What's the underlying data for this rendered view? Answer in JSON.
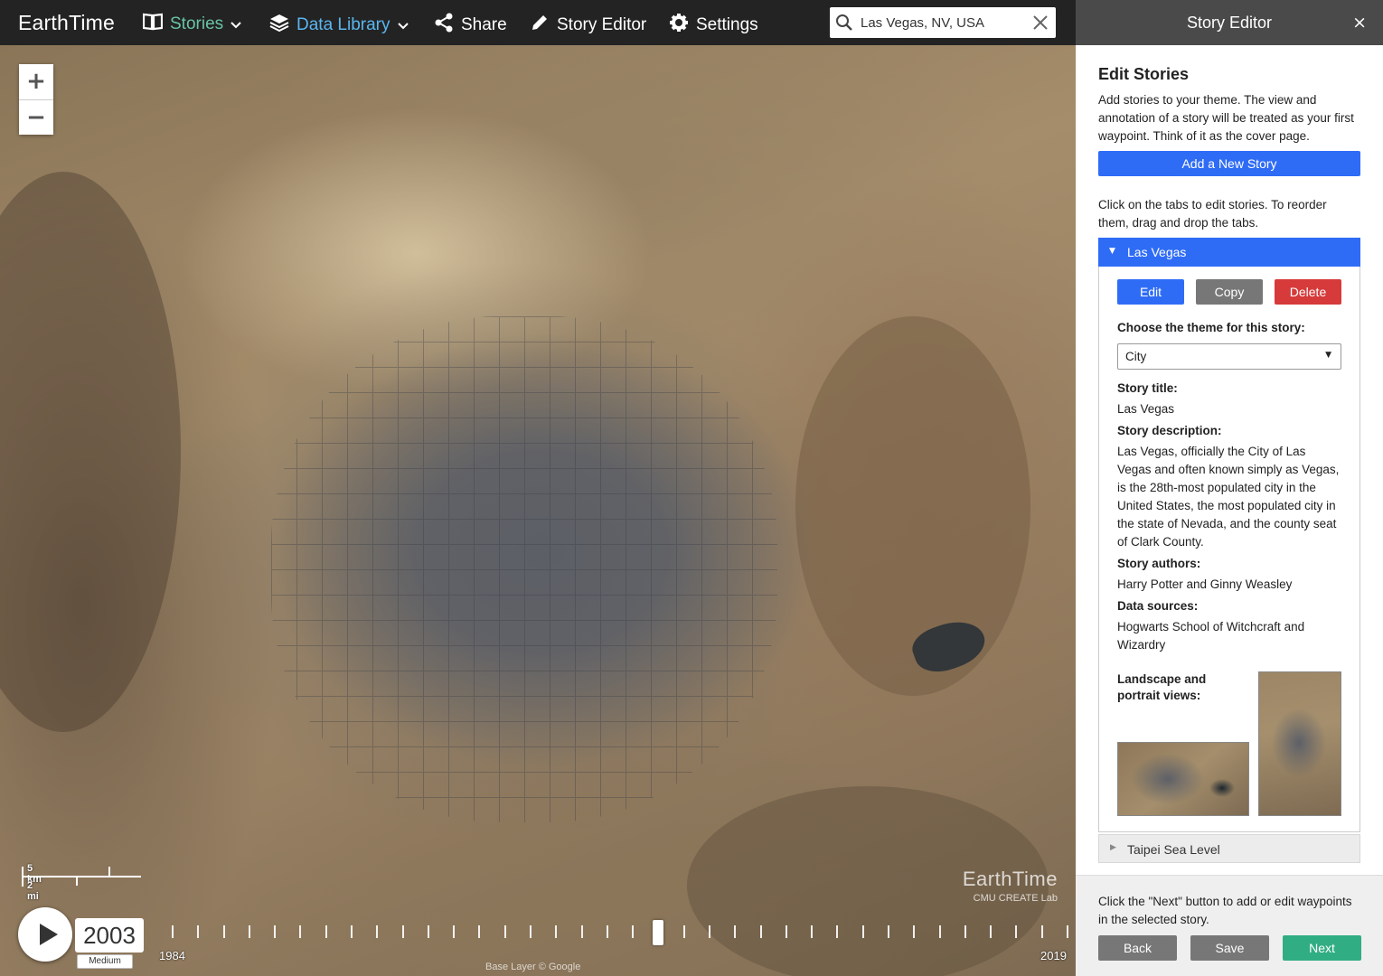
{
  "app": {
    "brand": "EarthTime"
  },
  "nav": {
    "stories": "Stories",
    "data_library": "Data Library",
    "share": "Share",
    "story_editor": "Story Editor",
    "settings": "Settings"
  },
  "search": {
    "value": "Las Vegas, NV, USA"
  },
  "map": {
    "zoom_in": "+",
    "zoom_out": "−",
    "scale_km": "5 km",
    "scale_mi": "2 mi",
    "watermark_title": "EarthTime",
    "watermark_sub": "CMU CREATE Lab",
    "base_layer": "Base Layer © Google"
  },
  "timeline": {
    "current_year": "2003",
    "speed": "Medium",
    "start_year": "1984",
    "end_year": "2019",
    "tick_count": 36
  },
  "panel": {
    "title": "Story Editor",
    "close": "×",
    "edit_title": "Edit Stories",
    "intro": "Add stories to your theme. The view and annotation of a story will be treated as your first waypoint. Think of it as the cover page.",
    "add_button": "Add a New Story",
    "hint": "Click on the tabs to edit stories. To reorder them, drag and drop the tabs.",
    "stories": [
      {
        "name": "Las Vegas",
        "expanded": true,
        "buttons": {
          "edit": "Edit",
          "copy": "Copy",
          "delete": "Delete"
        },
        "theme_label": "Choose the theme for this story:",
        "theme_value": "City",
        "title_label": "Story title:",
        "title_value": "Las Vegas",
        "description_label": "Story description:",
        "description_value": "Las Vegas, officially the City of Las Vegas and often known simply as Vegas, is the 28th-most populated city in the United States, the most populated city in the state of Nevada, and the county seat of Clark County.",
        "authors_label": "Story authors:",
        "authors_value": "Harry Potter and Ginny Weasley",
        "sources_label": "Data sources:",
        "sources_value": "Hogwarts School of Witchcraft and Wizardry",
        "views_label": "Landscape and portrait views:"
      },
      {
        "name": "Taipei Sea Level",
        "expanded": false
      }
    ],
    "footer_hint": "Click the \"Next\" button to add or edit waypoints in the selected story.",
    "footer_buttons": {
      "back": "Back",
      "save": "Save",
      "next": "Next"
    }
  },
  "colors": {
    "topbar": "#232323",
    "panel_header": "#4a4a4a",
    "primary_blue": "#2f6cf6",
    "copy_gray": "#777777",
    "delete_red": "#d63a3a",
    "next_green": "#31ad83",
    "nav_accent": "#5ab6f0",
    "nav_green": "#69c3a5"
  }
}
